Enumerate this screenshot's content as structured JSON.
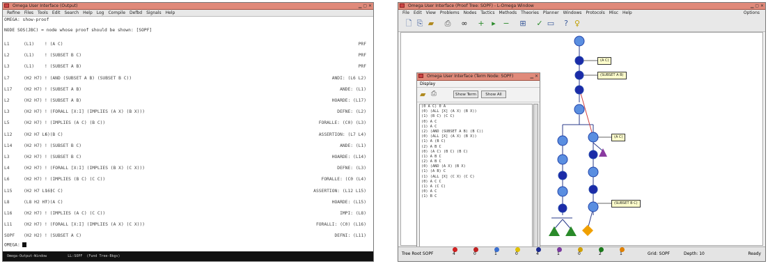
{
  "console": {
    "title": "Omega User Interface (Output)",
    "menu": [
      "Refine",
      "Files",
      "Tools",
      "Edit",
      "Search",
      "Help",
      "Log",
      "Compile",
      "Defbd",
      "Signals",
      "Help"
    ],
    "prompt_line": "OMEGA: show-proof",
    "header_line": "NODE SOS(JBC) = node whose proof should be shown: [SOPF]",
    "rows": [
      {
        "label": "L1",
        "code": "(L1)",
        "expr": "! (A C)",
        "just": "PRF"
      },
      {
        "label": "L2",
        "code": "(L1)",
        "expr": "! (SUBSET B C)",
        "just": "PRF"
      },
      {
        "label": "L3",
        "code": "(L1)",
        "expr": "! (SUBSET A B)",
        "just": "PRF"
      },
      {
        "label": "L7",
        "code": "(H2 H7)",
        "expr": "! (AND (SUBSET A B) (SUBSET B C))",
        "just": "ANDI: (L6 L2)"
      },
      {
        "label": "L17",
        "code": "(H2 H7)",
        "expr": "! (SUBSET A B)",
        "just": "ANDE: (L1)"
      },
      {
        "label": "L2",
        "code": "(H2 H7)",
        "expr": "! (SUBSET A B)",
        "just": "HOARDE: (L17)"
      },
      {
        "label": "L3",
        "code": "(H2 H7)",
        "expr": "! (FORALL [X:I] (IMPLIES (A X) (B X)))",
        "just": "DEFNE: (L2)"
      },
      {
        "label": "L5",
        "code": "(H2 H7)",
        "expr": "! (IMPLIES (A C) (B C))",
        "just": "FORALLE: (C0) (L3)"
      },
      {
        "label": "L12",
        "code": "(H2 H7 L6)",
        "expr": "! (B C)",
        "just": "ASSERTION: (L7 L4)"
      },
      {
        "label": "L14",
        "code": "(H2 H7)",
        "expr": "! (SUBSET B C)",
        "just": "ANDE: (L1)"
      },
      {
        "label": "L3",
        "code": "(H2 H7)",
        "expr": "! (SUBSET B C)",
        "just": "HOARDE: (L14)"
      },
      {
        "label": "L4",
        "code": "(H2 H7)",
        "expr": "! (FORALL [X:I] (IMPLIES (B X) (C X)))",
        "just": "DEFNE: (L3)"
      },
      {
        "label": "L6",
        "code": "(H2 H7)",
        "expr": "! (IMPLIES (B C) (C C))",
        "just": "FORALLE: (C0 (L4)"
      },
      {
        "label": "L15",
        "code": "(H2 H7 L16)",
        "expr": "! (C C)",
        "just": "ASSERTION: (L12 L15)"
      },
      {
        "label": "L8",
        "code": "(L8 H2 H7)",
        "expr": "! (A C)",
        "just": "HOARDE: (L15)"
      },
      {
        "label": "L16",
        "code": "(H2 H7)",
        "expr": "! (IMPLIES (A C) (C C))",
        "just": "IMPI: (L8)"
      },
      {
        "label": "L11",
        "code": "(H2 H7)",
        "expr": "! (FORALL [X:I] (IMPLIES (A X) (C X)))",
        "just": "FORALLI: (C0) (L16)"
      },
      {
        "label": "SOPF",
        "code": "(H2 H2)",
        "expr": "! (SUBSET A C)",
        "just": "DEFNI: (L11)"
      }
    ],
    "input_prompt": "OMEGA:",
    "statusbar": "Omega-Output-Window          LL:SOPF  (Fund Tree-Bkgs)"
  },
  "graph": {
    "title": "Omega User Interface (Proof Tree: SOPF) - L-Omega Window",
    "menu": [
      "File",
      "Edit",
      "View",
      "Problems",
      "Nodes",
      "Tactics",
      "Methods",
      "Theories",
      "Planner",
      "Windows",
      "Protocols",
      "Misc",
      "Help"
    ],
    "menu_right": "Options",
    "toolbar_icons": [
      "new-doc-icon",
      "open-icon",
      "folder-icon",
      "print-icon",
      "binoculars-icon",
      "zoom-in-icon",
      "zoom-arrow-icon",
      "zoom-out-icon",
      "hierarchy-icon",
      "check-icon",
      "window-icon",
      "question-icon",
      "lightbulb-icon"
    ],
    "tree_labels": [
      "(A C)",
      "(SUBSET A B)",
      "(A C)",
      "(SUBSET B C)"
    ],
    "subwindow": {
      "title": "Omega User Interface (Term Node: SOPF)",
      "menu": "Display",
      "buttons": [
        "Show Term",
        "Show All"
      ],
      "lines": [
        "(0 A C) 0 A",
        "(0) (ALL [X] (A X) (B X))",
        "(1) (B C) (C C)",
        "(0) A C",
        "(1) A C",
        "(2) (AND (SUBSET A B) (B C))",
        "(0) (ALL [X] (A X) (B X))",
        "(1) A (B C)",
        "(2) A B C",
        "(0) (A C) (B C) (B C)",
        "(1) A B C",
        "(2) A B C",
        "(0) (AND (A X) (B X)",
        "(1) (A B) C",
        "(1) (ALL [X] (C X) (C C)",
        "(0) A C C",
        "(1) A (C C)",
        "(0) A C",
        "(1) B C"
      ]
    },
    "status": {
      "left": "Tree  Root SOPF",
      "legend": [
        {
          "color": "#d02020",
          "text": "4"
        },
        {
          "color": "#c02020",
          "text": "0"
        },
        {
          "color": "#3a6fd0",
          "text": "1"
        },
        {
          "color": "#e0c000",
          "text": "0"
        },
        {
          "color": "#1c2a90",
          "text": "4"
        },
        {
          "color": "#7a3aa0",
          "text": "1"
        },
        {
          "color": "#d0a000",
          "text": "0"
        },
        {
          "color": "#1a7a1a",
          "text": "2"
        },
        {
          "color": "#e08000",
          "text": "1"
        }
      ],
      "right1": "Grid: SOPF",
      "right2": "Depth: 10",
      "far_right": "Ready"
    },
    "colors": {
      "node_dark": "#1b2ba8",
      "node_light": "#5a8ee0",
      "node_outline": "#2244aa",
      "triangle_green": "#2a8a2a",
      "triangle_purple": "#8a3aa0",
      "diamond_orange": "#f0a000",
      "link_red": "#d04040"
    }
  }
}
